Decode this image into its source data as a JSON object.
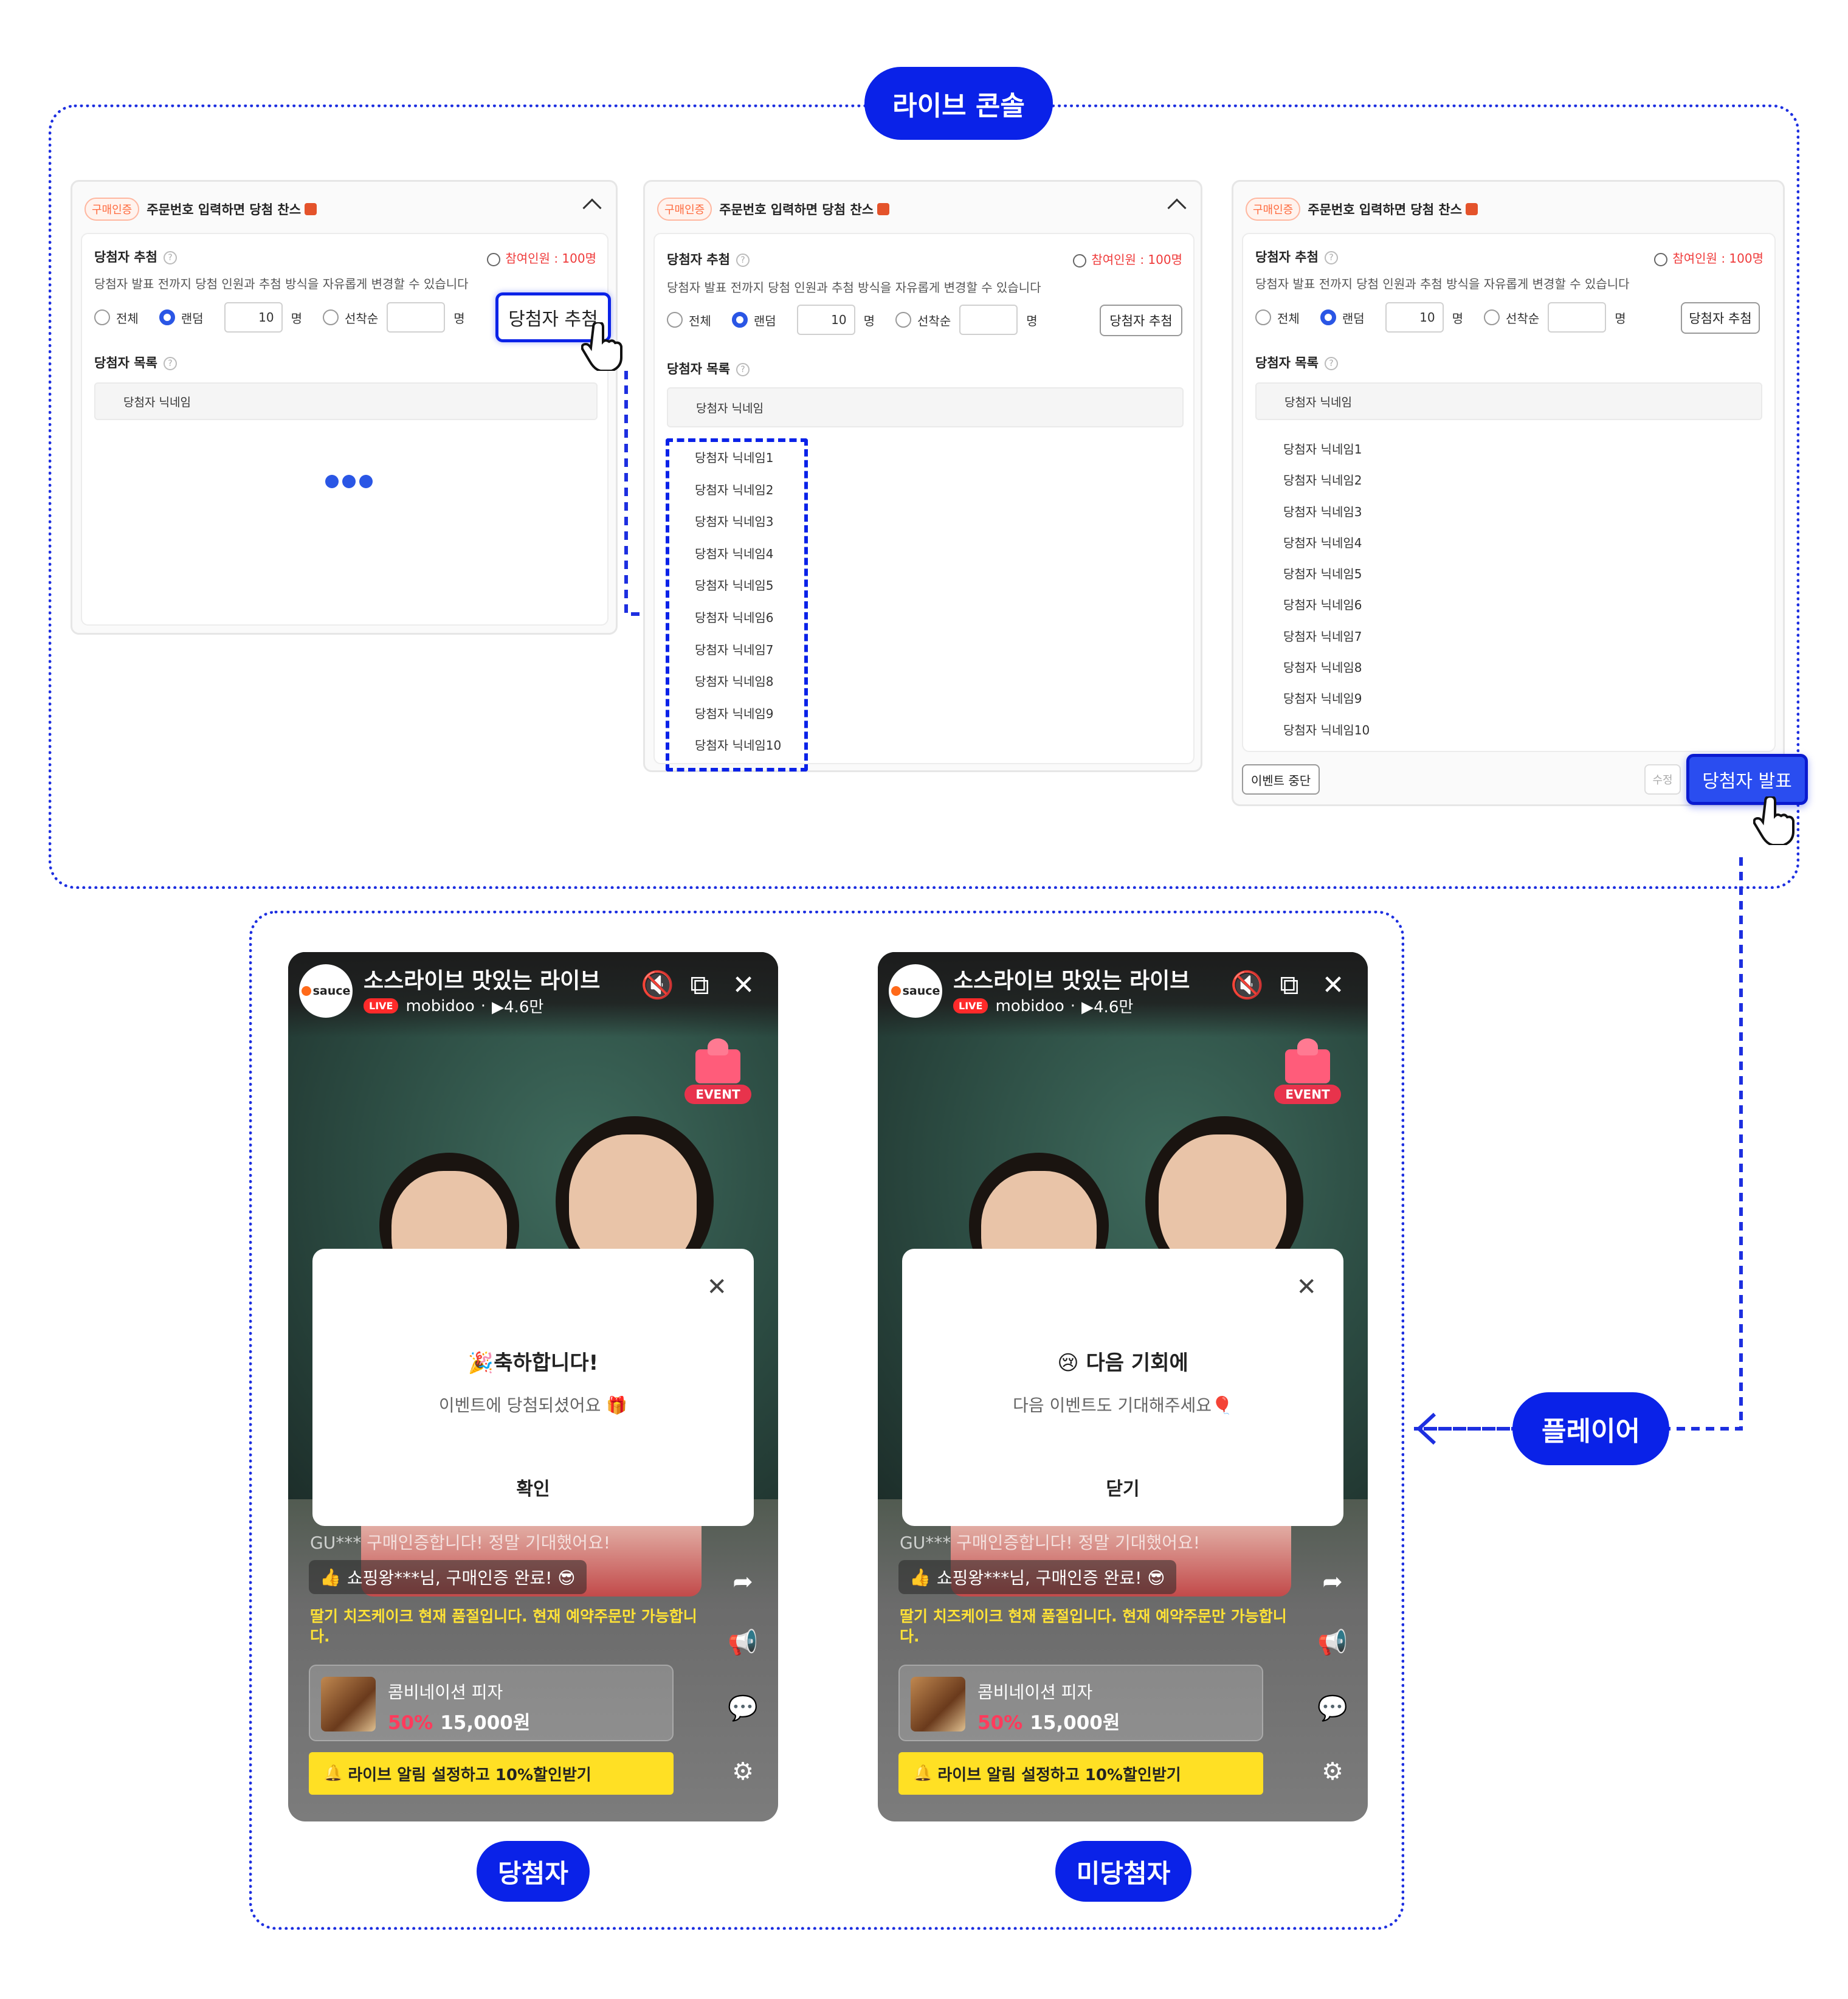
{
  "sections": {
    "console_label": "라이브 콘솔",
    "player_label": "플레이어",
    "winner_label": "당첨자",
    "loser_label": "미당첨자"
  },
  "console": {
    "badge": "구매인증",
    "title": "주문번호 입력하면 당첨 찬스",
    "draw_label": "당첨자 추첨",
    "participants": "참여인원 : 100명",
    "description": "당첨자 발표 전까지 당첨 인원과 추첨 방식을 자유롭게 변경할 수 있습니다",
    "options": {
      "all": "전체",
      "random": "랜덤",
      "random_count": "10",
      "unit": "명",
      "order": "선착순",
      "order_count": ""
    },
    "draw_button": "당첨자 추첨",
    "list_label": "당첨자 목록",
    "column_header": "당첨자 닉네임",
    "winners": [
      "당첨자 닉네임1",
      "당첨자 닉네임2",
      "당첨자 닉네임3",
      "당첨자 닉네임4",
      "당첨자 닉네임5",
      "당첨자 닉네임6",
      "당첨자 닉네임7",
      "당첨자 닉네임8",
      "당첨자 닉네임9",
      "당첨자 닉네임10"
    ],
    "stop_button": "이벤트 중단",
    "edit_button": "수정",
    "announce_button": "당첨자 발표"
  },
  "player": {
    "brand": "sauce",
    "title": "소스라이브 맛있는 라이브",
    "live": "LIVE",
    "channel": "mobidoo",
    "views": "▶4.6만",
    "event_tag": "EVENT",
    "chat_faded": "GU***   구매인증합니다! 정말 기대했어요!",
    "chat_highlight": "쇼핑왕***님, 구매인증 완료! 😎",
    "notice": "딸기 치즈케이크 현재 품절입니다. 현재 예약주문만 가능합니다.",
    "product_name": "콤비네이션 피자",
    "discount": "50%",
    "price": "15,000원",
    "alarm": "라이브 알림 설정하고 10%할인받기"
  },
  "modals": {
    "winner": {
      "title": "🎉축하합니다!",
      "subtitle": "이벤트에 당첨되셨어요 🎁",
      "button": "확인"
    },
    "loser": {
      "title": "😢 다음 기회에",
      "subtitle": "다음 이벤트도 기대해주세요🎈",
      "button": "닫기"
    }
  },
  "colors": {
    "accent": "#0a22e8",
    "participants": "#ef3b3b",
    "alarm": "#ffe024",
    "notice": "#ffe236"
  }
}
